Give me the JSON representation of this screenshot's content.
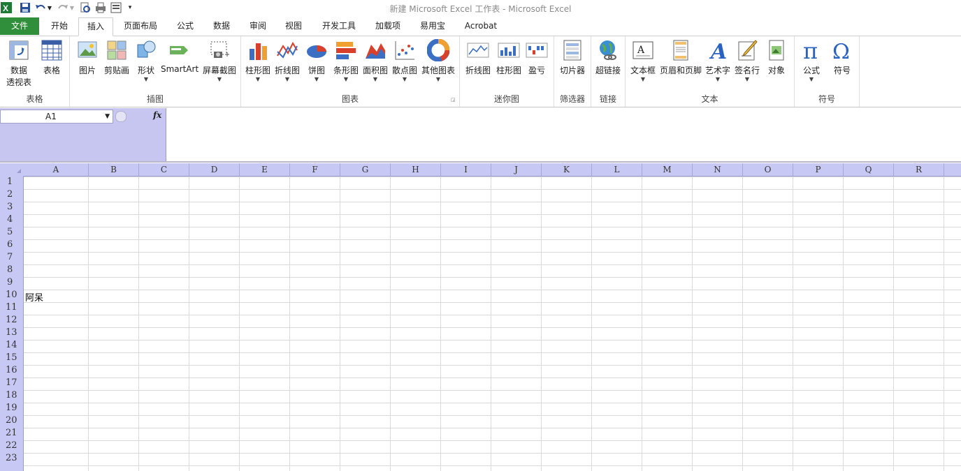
{
  "window": {
    "title": "新建 Microsoft Excel 工作表 - Microsoft Excel"
  },
  "quick_access": [
    "excel-logo-icon",
    "save-icon",
    "undo-icon",
    "redo-icon",
    "print-preview-icon",
    "print-icon",
    "form-icon",
    "customize-icon"
  ],
  "tabs": [
    {
      "label": "文件",
      "key": "file"
    },
    {
      "label": "开始",
      "key": "home"
    },
    {
      "label": "插入",
      "key": "insert",
      "active": true
    },
    {
      "label": "页面布局",
      "key": "page-layout"
    },
    {
      "label": "公式",
      "key": "formulas"
    },
    {
      "label": "数据",
      "key": "data"
    },
    {
      "label": "审阅",
      "key": "review"
    },
    {
      "label": "视图",
      "key": "view"
    },
    {
      "label": "开发工具",
      "key": "developer"
    },
    {
      "label": "加载项",
      "key": "addins"
    },
    {
      "label": "易用宝",
      "key": "easyuse"
    },
    {
      "label": "Acrobat",
      "key": "acrobat"
    }
  ],
  "ribbon": {
    "groups": {
      "tables": {
        "label": "表格",
        "buttons": {
          "pivot": "数据",
          "pivot2": "透视表",
          "table": "表格"
        }
      },
      "illustrations": {
        "label": "插图",
        "buttons": {
          "picture": "图片",
          "clipart": "剪贴画",
          "shapes": "形状",
          "smartart": "SmartArt",
          "screenshot": "屏幕截图"
        }
      },
      "charts": {
        "label": "图表",
        "buttons": {
          "column": "柱形图",
          "line": "折线图",
          "pie": "饼图",
          "bar": "条形图",
          "area": "面积图",
          "scatter": "散点图",
          "other": "其他图表"
        }
      },
      "sparklines": {
        "label": "迷你图",
        "buttons": {
          "line": "折线图",
          "column": "柱形图",
          "winloss": "盈亏"
        }
      },
      "filter": {
        "label": "筛选器",
        "buttons": {
          "slicer": "切片器"
        }
      },
      "links": {
        "label": "链接",
        "buttons": {
          "hyperlink": "超链接"
        }
      },
      "text": {
        "label": "文本",
        "buttons": {
          "textbox": "文本框",
          "headerfooter": "页眉和页脚",
          "wordart": "艺术字",
          "signature": "签名行",
          "object": "对象"
        }
      },
      "symbols": {
        "label": "符号",
        "buttons": {
          "equation": "公式",
          "symbol": "符号"
        }
      }
    }
  },
  "formula_bar": {
    "name_box": "A1",
    "fx_label": "fx",
    "formula": ""
  },
  "sheet": {
    "columns": [
      "A",
      "B",
      "C",
      "D",
      "E",
      "F",
      "G",
      "H",
      "I",
      "J",
      "K",
      "L",
      "M",
      "N",
      "O",
      "P",
      "Q",
      "R"
    ],
    "rows": [
      "1",
      "2",
      "3",
      "4",
      "5",
      "6",
      "7",
      "8",
      "9",
      "10",
      "11",
      "12",
      "13",
      "14",
      "15",
      "16",
      "17",
      "18",
      "19",
      "20",
      "21",
      "22",
      "23"
    ],
    "cells": {
      "A10": "阿呆"
    }
  },
  "colors": {
    "file_tab": "#2f8f3a",
    "header_bg": "#c8c8f4",
    "name_area": "#c6c6f0"
  }
}
